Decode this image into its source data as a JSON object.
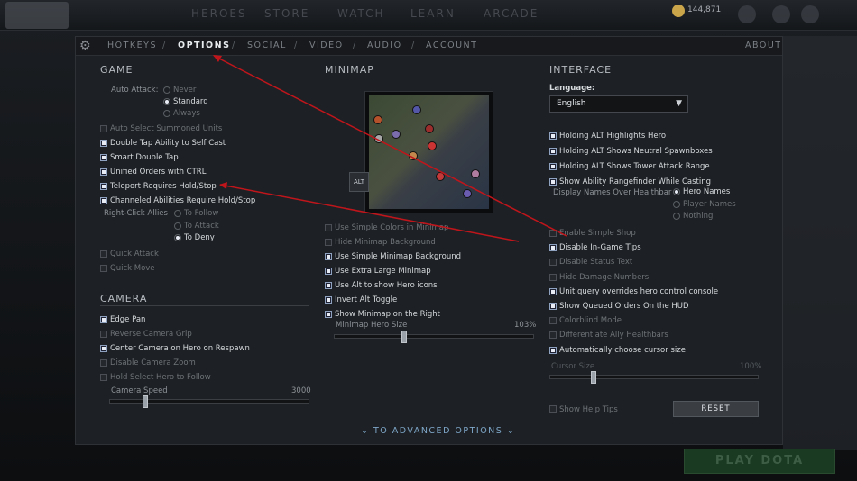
{
  "app": {
    "top_nav": [
      "HEROES",
      "STORE",
      "WATCH",
      "LEARN",
      "ARCADE"
    ],
    "currency": "144,871",
    "play_button": "PLAY DOTA"
  },
  "tabs": [
    "HOTKEYS",
    "OPTIONS",
    "SOCIAL",
    "VIDEO",
    "AUDIO",
    "ACCOUNT"
  ],
  "tab_separator": "/",
  "active_tab": "OPTIONS",
  "about": "ABOUT",
  "game": {
    "title": "GAME",
    "auto_attack_label": "Auto Attack:",
    "auto_attack_options": [
      {
        "label": "Never",
        "selected": false
      },
      {
        "label": "Standard",
        "selected": true
      },
      {
        "label": "Always",
        "selected": false
      }
    ],
    "checkboxes": [
      {
        "label": "Auto Select Summoned Units",
        "checked": false
      },
      {
        "label": "Double Tap Ability to Self Cast",
        "checked": true
      },
      {
        "label": "Smart Double Tap",
        "checked": true
      },
      {
        "label": "Unified Orders with CTRL",
        "checked": true
      },
      {
        "label": "Teleport Requires Hold/Stop",
        "checked": true
      },
      {
        "label": "Channeled Abilities Require Hold/Stop",
        "checked": true
      }
    ],
    "right_click_label": "Right-Click Allies",
    "right_click_options": [
      {
        "label": "To Follow",
        "selected": false
      },
      {
        "label": "To Attack",
        "selected": false
      },
      {
        "label": "To Deny",
        "selected": true
      }
    ],
    "checkboxes2": [
      {
        "label": "Quick Attack",
        "checked": false
      },
      {
        "label": "Quick Move",
        "checked": false
      }
    ]
  },
  "camera": {
    "title": "CAMERA",
    "checkboxes": [
      {
        "label": "Edge Pan",
        "checked": true
      },
      {
        "label": "Reverse Camera Grip",
        "checked": false
      },
      {
        "label": "Center Camera on Hero on Respawn",
        "checked": true
      },
      {
        "label": "Disable Camera Zoom",
        "checked": false
      },
      {
        "label": "Hold Select Hero to Follow",
        "checked": false
      }
    ],
    "speed_label": "Camera Speed",
    "speed_value": "3000",
    "speed_fraction": 0.18
  },
  "minimap": {
    "title": "MINIMAP",
    "alt_label": "ALT",
    "checkboxes": [
      {
        "label": "Use Simple Colors in Minimap",
        "checked": false
      },
      {
        "label": "Hide Minimap Background",
        "checked": false
      },
      {
        "label": "Use Simple Minimap Background",
        "checked": true
      },
      {
        "label": "Use Extra Large Minimap",
        "checked": true
      },
      {
        "label": "Use Alt to show Hero icons",
        "checked": true
      },
      {
        "label": "Invert Alt Toggle",
        "checked": true
      },
      {
        "label": "Show Minimap on the Right",
        "checked": true
      }
    ],
    "hero_size_label": "Minimap Hero Size",
    "hero_size_value": "103%",
    "hero_size_fraction": 0.35
  },
  "interface": {
    "title": "INTERFACE",
    "language_label": "Language:",
    "language_value": "English",
    "checkboxes": [
      {
        "label": "Holding ALT Highlights Hero",
        "checked": true
      },
      {
        "label": "Holding ALT Shows Neutral Spawnboxes",
        "checked": true
      },
      {
        "label": "Holding ALT Shows Tower Attack Range",
        "checked": true
      },
      {
        "label": "Show Ability Rangefinder While Casting",
        "checked": true
      }
    ],
    "names_label": "Display Names Over Healthbar",
    "names_options": [
      {
        "label": "Hero Names",
        "selected": true
      },
      {
        "label": "Player Names",
        "selected": false
      },
      {
        "label": "Nothing",
        "selected": false
      }
    ],
    "checkboxes2": [
      {
        "label": "Enable Simple Shop",
        "checked": false
      },
      {
        "label": "Disable In-Game Tips",
        "checked": true
      },
      {
        "label": "Disable Status Text",
        "checked": false
      },
      {
        "label": "Hide Damage Numbers",
        "checked": false
      },
      {
        "label": "Unit query overrides hero control console",
        "checked": true
      },
      {
        "label": "Show Queued Orders On the HUD",
        "checked": true
      },
      {
        "label": "Colorblind Mode",
        "checked": false
      },
      {
        "label": "Differentiate Ally Healthbars",
        "checked": false
      },
      {
        "label": "Automatically choose cursor size",
        "checked": true
      }
    ],
    "cursor_label": "Cursor Size",
    "cursor_value": "100%",
    "cursor_fraction": 0.21,
    "help_tips": {
      "label": "Show Help Tips",
      "checked": false
    },
    "reset": "RESET"
  },
  "advanced": "TO ADVANCED OPTIONS",
  "colors": {
    "accent": "#7fa7c9",
    "annotation": "#c0151b"
  }
}
